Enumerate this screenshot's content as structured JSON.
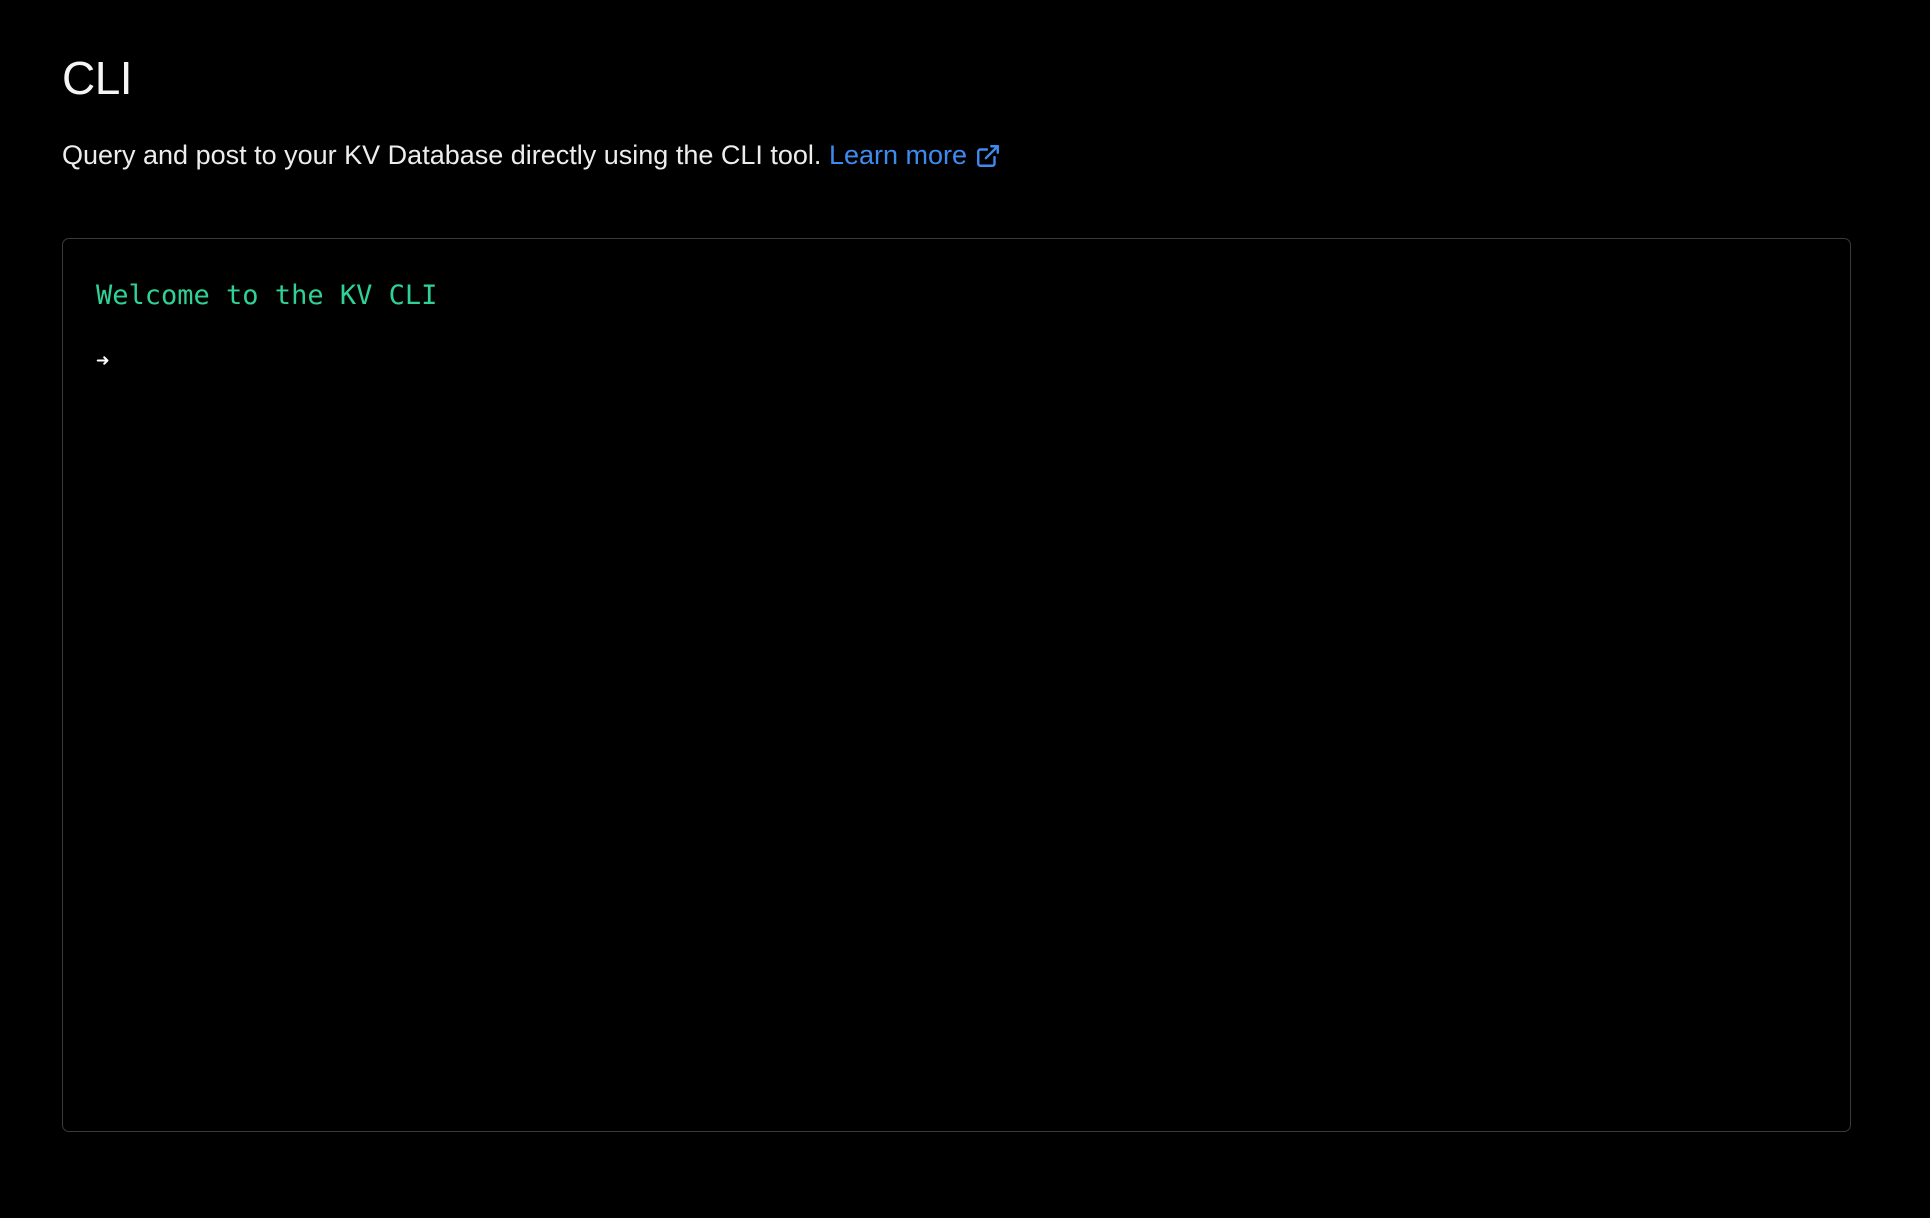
{
  "header": {
    "title": "CLI",
    "description": "Query and post to your KV Database directly using the CLI tool.",
    "learn_more_label": "Learn more",
    "learn_more_icon": "external-link-icon"
  },
  "terminal": {
    "welcome_message": "Welcome to the KV CLI",
    "prompt_symbol": "➜",
    "input_value": ""
  },
  "colors": {
    "background": "#000000",
    "link": "#3e8bf0",
    "terminal_welcome": "#2fd196",
    "terminal_border": "#3a3a3a"
  }
}
